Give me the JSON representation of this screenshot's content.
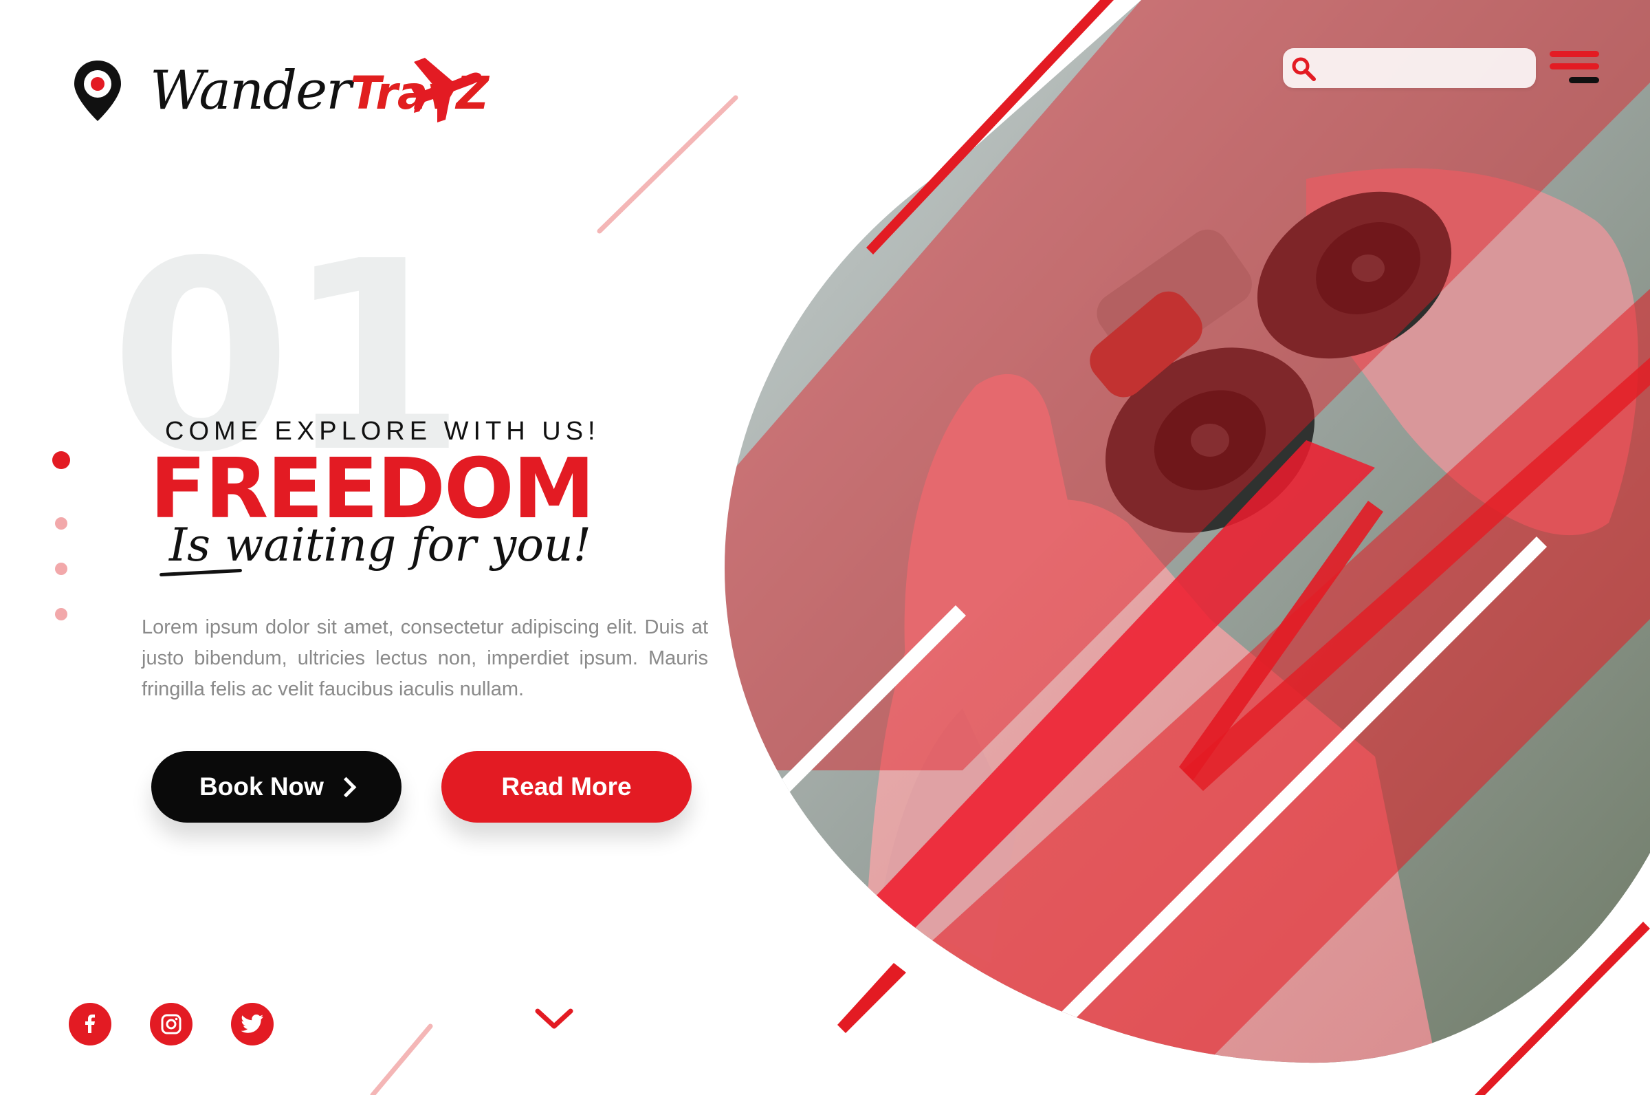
{
  "brand": {
    "name_part1": "Wander",
    "name_part2": "TravZ"
  },
  "search": {
    "placeholder": "",
    "value": ""
  },
  "hero": {
    "slide_number": "01",
    "tagline": "COME EXPLORE WITH US!",
    "headline": "FREEDOM",
    "script": "Is waiting for you!",
    "body": "Lorem ipsum dolor sit amet, consectetur adipiscing elit. Duis at justo bibendum, ultricies lectus non, imperdiet ipsum. Mauris fringilla felis ac velit faucibus iaculis nullam."
  },
  "buttons": {
    "book_now": "Book Now",
    "read_more": "Read More"
  },
  "pagination": {
    "total": 4,
    "active_index": 0
  },
  "social": [
    "facebook-icon",
    "instagram-icon",
    "twitter-icon"
  ],
  "colors": {
    "accent": "#e31b23",
    "dark": "#0a0a0a",
    "muted_text": "#8a8a8a",
    "number_watermark": "#eceeee"
  }
}
